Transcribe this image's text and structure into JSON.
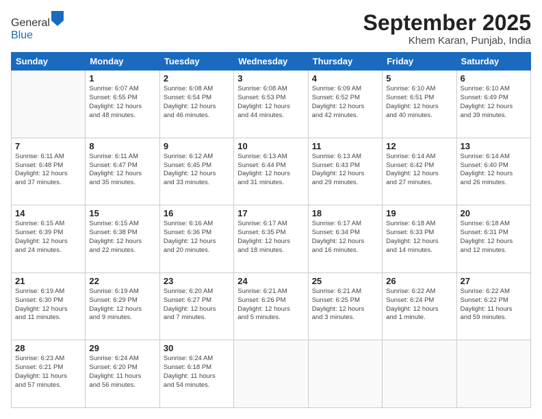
{
  "header": {
    "logo_general": "General",
    "logo_blue": "Blue",
    "month_title": "September 2025",
    "location": "Khem Karan, Punjab, India"
  },
  "days_of_week": [
    "Sunday",
    "Monday",
    "Tuesday",
    "Wednesday",
    "Thursday",
    "Friday",
    "Saturday"
  ],
  "weeks": [
    [
      {
        "day": "",
        "info": ""
      },
      {
        "day": "1",
        "info": "Sunrise: 6:07 AM\nSunset: 6:55 PM\nDaylight: 12 hours\nand 48 minutes."
      },
      {
        "day": "2",
        "info": "Sunrise: 6:08 AM\nSunset: 6:54 PM\nDaylight: 12 hours\nand 46 minutes."
      },
      {
        "day": "3",
        "info": "Sunrise: 6:08 AM\nSunset: 6:53 PM\nDaylight: 12 hours\nand 44 minutes."
      },
      {
        "day": "4",
        "info": "Sunrise: 6:09 AM\nSunset: 6:52 PM\nDaylight: 12 hours\nand 42 minutes."
      },
      {
        "day": "5",
        "info": "Sunrise: 6:10 AM\nSunset: 6:51 PM\nDaylight: 12 hours\nand 40 minutes."
      },
      {
        "day": "6",
        "info": "Sunrise: 6:10 AM\nSunset: 6:49 PM\nDaylight: 12 hours\nand 39 minutes."
      }
    ],
    [
      {
        "day": "7",
        "info": "Sunrise: 6:11 AM\nSunset: 6:48 PM\nDaylight: 12 hours\nand 37 minutes."
      },
      {
        "day": "8",
        "info": "Sunrise: 6:11 AM\nSunset: 6:47 PM\nDaylight: 12 hours\nand 35 minutes."
      },
      {
        "day": "9",
        "info": "Sunrise: 6:12 AM\nSunset: 6:45 PM\nDaylight: 12 hours\nand 33 minutes."
      },
      {
        "day": "10",
        "info": "Sunrise: 6:13 AM\nSunset: 6:44 PM\nDaylight: 12 hours\nand 31 minutes."
      },
      {
        "day": "11",
        "info": "Sunrise: 6:13 AM\nSunset: 6:43 PM\nDaylight: 12 hours\nand 29 minutes."
      },
      {
        "day": "12",
        "info": "Sunrise: 6:14 AM\nSunset: 6:42 PM\nDaylight: 12 hours\nand 27 minutes."
      },
      {
        "day": "13",
        "info": "Sunrise: 6:14 AM\nSunset: 6:40 PM\nDaylight: 12 hours\nand 26 minutes."
      }
    ],
    [
      {
        "day": "14",
        "info": "Sunrise: 6:15 AM\nSunset: 6:39 PM\nDaylight: 12 hours\nand 24 minutes."
      },
      {
        "day": "15",
        "info": "Sunrise: 6:15 AM\nSunset: 6:38 PM\nDaylight: 12 hours\nand 22 minutes."
      },
      {
        "day": "16",
        "info": "Sunrise: 6:16 AM\nSunset: 6:36 PM\nDaylight: 12 hours\nand 20 minutes."
      },
      {
        "day": "17",
        "info": "Sunrise: 6:17 AM\nSunset: 6:35 PM\nDaylight: 12 hours\nand 18 minutes."
      },
      {
        "day": "18",
        "info": "Sunrise: 6:17 AM\nSunset: 6:34 PM\nDaylight: 12 hours\nand 16 minutes."
      },
      {
        "day": "19",
        "info": "Sunrise: 6:18 AM\nSunset: 6:33 PM\nDaylight: 12 hours\nand 14 minutes."
      },
      {
        "day": "20",
        "info": "Sunrise: 6:18 AM\nSunset: 6:31 PM\nDaylight: 12 hours\nand 12 minutes."
      }
    ],
    [
      {
        "day": "21",
        "info": "Sunrise: 6:19 AM\nSunset: 6:30 PM\nDaylight: 12 hours\nand 11 minutes."
      },
      {
        "day": "22",
        "info": "Sunrise: 6:19 AM\nSunset: 6:29 PM\nDaylight: 12 hours\nand 9 minutes."
      },
      {
        "day": "23",
        "info": "Sunrise: 6:20 AM\nSunset: 6:27 PM\nDaylight: 12 hours\nand 7 minutes."
      },
      {
        "day": "24",
        "info": "Sunrise: 6:21 AM\nSunset: 6:26 PM\nDaylight: 12 hours\nand 5 minutes."
      },
      {
        "day": "25",
        "info": "Sunrise: 6:21 AM\nSunset: 6:25 PM\nDaylight: 12 hours\nand 3 minutes."
      },
      {
        "day": "26",
        "info": "Sunrise: 6:22 AM\nSunset: 6:24 PM\nDaylight: 12 hours\nand 1 minute."
      },
      {
        "day": "27",
        "info": "Sunrise: 6:22 AM\nSunset: 6:22 PM\nDaylight: 11 hours\nand 59 minutes."
      }
    ],
    [
      {
        "day": "28",
        "info": "Sunrise: 6:23 AM\nSunset: 6:21 PM\nDaylight: 11 hours\nand 57 minutes."
      },
      {
        "day": "29",
        "info": "Sunrise: 6:24 AM\nSunset: 6:20 PM\nDaylight: 11 hours\nand 56 minutes."
      },
      {
        "day": "30",
        "info": "Sunrise: 6:24 AM\nSunset: 6:18 PM\nDaylight: 11 hours\nand 54 minutes."
      },
      {
        "day": "",
        "info": ""
      },
      {
        "day": "",
        "info": ""
      },
      {
        "day": "",
        "info": ""
      },
      {
        "day": "",
        "info": ""
      }
    ]
  ]
}
